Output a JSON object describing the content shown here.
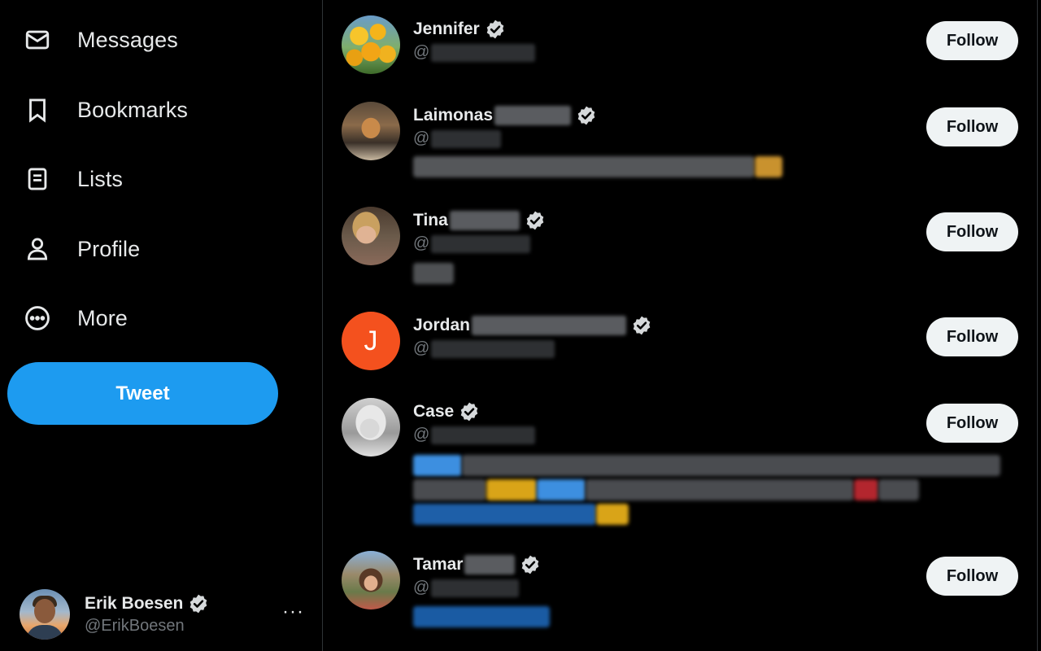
{
  "nav": {
    "items": [
      {
        "label": "Messages",
        "icon": "envelope-icon"
      },
      {
        "label": "Bookmarks",
        "icon": "bookmark-icon"
      },
      {
        "label": "Lists",
        "icon": "list-icon"
      },
      {
        "label": "Profile",
        "icon": "person-icon"
      },
      {
        "label": "More",
        "icon": "more-circle-icon"
      }
    ],
    "tweet_label": "Tweet"
  },
  "account": {
    "name": "Erik Boesen",
    "handle": "@ErikBoesen",
    "menu_glyph": "···"
  },
  "colors": {
    "accent": "#1d9bf0",
    "background": "#000000",
    "text_primary": "#e7e9ea",
    "text_secondary": "#71767b",
    "follow_bg": "#eff3f4",
    "jordan_avatar": "#f4511e"
  },
  "suggestions": [
    {
      "name": "Jennifer",
      "handle_prefix": "@",
      "follow_label": "Follow"
    },
    {
      "name": "Laimonas",
      "handle_prefix": "@",
      "follow_label": "Follow"
    },
    {
      "name": "Tina",
      "handle_prefix": "@",
      "follow_label": "Follow"
    },
    {
      "name": "Jordan",
      "handle_prefix": "@",
      "follow_label": "Follow",
      "avatar_letter": "J"
    },
    {
      "name": "Case",
      "handle_prefix": "@",
      "follow_label": "Follow"
    },
    {
      "name": "Tamar",
      "handle_prefix": "@",
      "follow_label": "Follow"
    }
  ]
}
